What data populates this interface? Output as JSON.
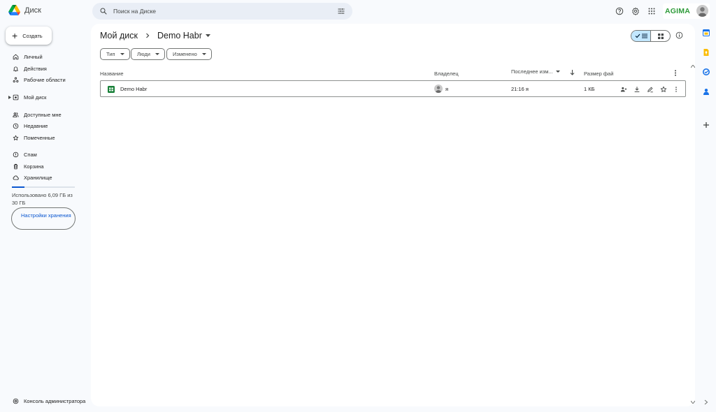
{
  "app": {
    "name": "Диск"
  },
  "search": {
    "placeholder": "Поиск на Диске"
  },
  "header": {
    "brand": "AGIMA"
  },
  "create": {
    "label": "Создать"
  },
  "nav": {
    "personal": "Личный",
    "activity": "Действия",
    "workspaces": "Рабочие области",
    "my_drive": "Мой диск",
    "shared": "Доступные мне",
    "recent": "Недавние",
    "starred": "Помеченные",
    "spam": "Спам",
    "trash": "Корзина",
    "storage": "Хранилище"
  },
  "storage": {
    "used_fraction": 0.2,
    "usage_text": "Использовано 6,09 ГБ из 30 ГБ",
    "settings_button": "Настройки хранения"
  },
  "admin": {
    "label": "Консоль администратора"
  },
  "breadcrumb": {
    "root": "Мой диск",
    "current": "Demo Habr"
  },
  "filters": {
    "type": "Тип",
    "people": "Люди",
    "modified": "Изменено"
  },
  "table": {
    "headers": {
      "name": "Название",
      "owner": "Владелец",
      "modified": "Последнее изм...",
      "size": "Размер фай"
    },
    "rows": [
      {
        "name": "Demo Habr",
        "owner": "я",
        "modified": "21:16 я",
        "size": "1 КБ",
        "type_icon": "sheets-icon"
      }
    ]
  },
  "colors": {
    "accent": "#0b57d0",
    "selected_toggle": "#c2e7ff",
    "brand_green": "#2e9b3a",
    "sheets_green": "#188038"
  }
}
